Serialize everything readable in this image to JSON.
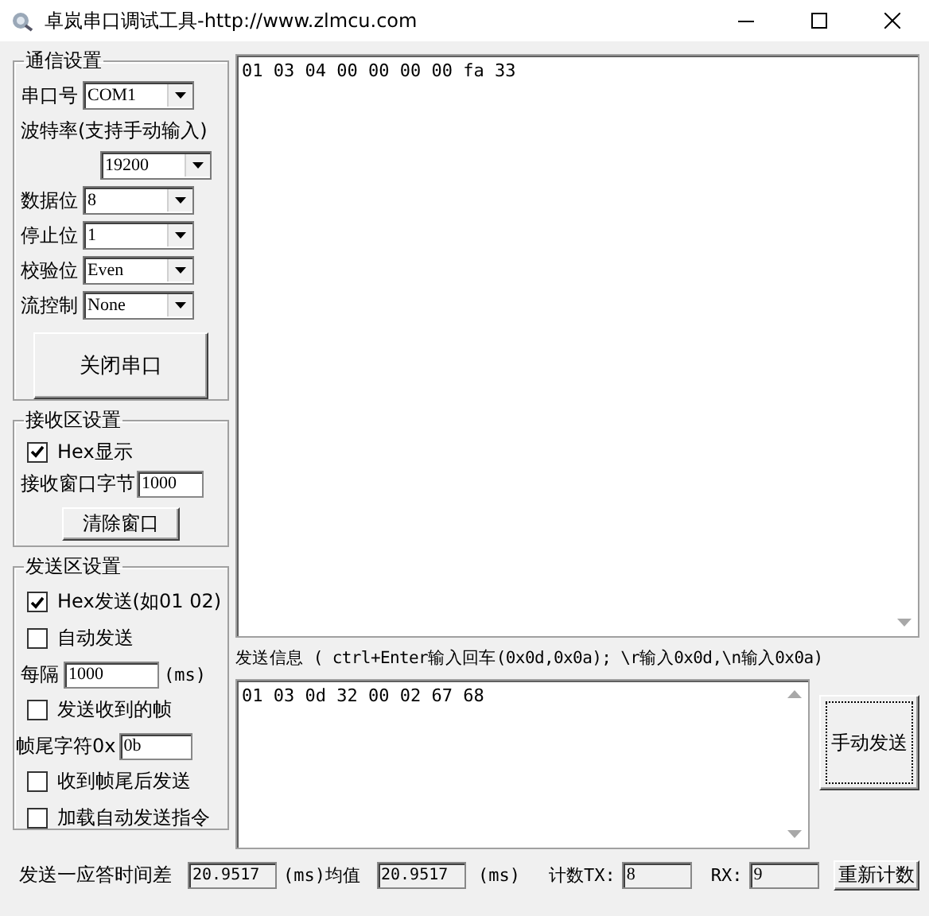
{
  "window": {
    "title": "卓岚串口调试工具-http://www.zlmcu.com"
  },
  "comm_settings": {
    "title": "通信设置",
    "fields": [
      {
        "kind": "inline",
        "label": "串口号",
        "value": "COM1"
      },
      {
        "kind": "stacked",
        "label": "波特率(支持手动输入)",
        "value": "19200"
      },
      {
        "kind": "inline",
        "label": "数据位",
        "value": "8"
      },
      {
        "kind": "inline",
        "label": "停止位",
        "value": "1"
      },
      {
        "kind": "inline",
        "label": "校验位",
        "value": "Even"
      },
      {
        "kind": "inline",
        "label": "流控制",
        "value": "None"
      }
    ],
    "button": "关闭串口"
  },
  "receive_settings": {
    "title": "接收区设置",
    "hex_display": {
      "label": "Hex显示",
      "checked": true
    },
    "buffer_label": "接收窗口字节",
    "buffer": "1000",
    "clear_button": "清除窗口"
  },
  "send_settings": {
    "title": "发送区设置",
    "options": [
      {
        "kind": "checkbox",
        "label": "Hex发送(如01 02)",
        "checked": true
      },
      {
        "kind": "checkbox",
        "label": "自动发送",
        "checked": false
      },
      {
        "kind": "interval",
        "label": "每隔",
        "value": "1000",
        "unit": "(ms)"
      },
      {
        "kind": "checkbox",
        "label": "发送收到的帧",
        "checked": false
      },
      {
        "kind": "field",
        "label": "帧尾字符0x",
        "value": "0b"
      },
      {
        "kind": "checkbox",
        "label": "收到帧尾后发送",
        "checked": false
      },
      {
        "kind": "checkbox",
        "label": "加载自动发送指令",
        "checked": false
      }
    ]
  },
  "receive_area": {
    "text": "01 03 04 00 00 00 00 fa 33"
  },
  "send_area": {
    "label": "发送信息 ( ctrl+Enter输入回车(0x0d,0x0a); \\r输入0x0d,\\n输入0x0a)",
    "text": "01 03 0d 32 00 02 67 68",
    "button": "手动发送"
  },
  "status_bar": {
    "delay_label": "发送一应答时间差",
    "delay": "20.9517",
    "delay_unit": "(ms)均值",
    "average": "20.9517",
    "average_unit": "(ms)",
    "count_label": "计数TX:",
    "tx": "8",
    "rx_label": "RX:",
    "rx": "9",
    "reset_button": "重新计数"
  }
}
